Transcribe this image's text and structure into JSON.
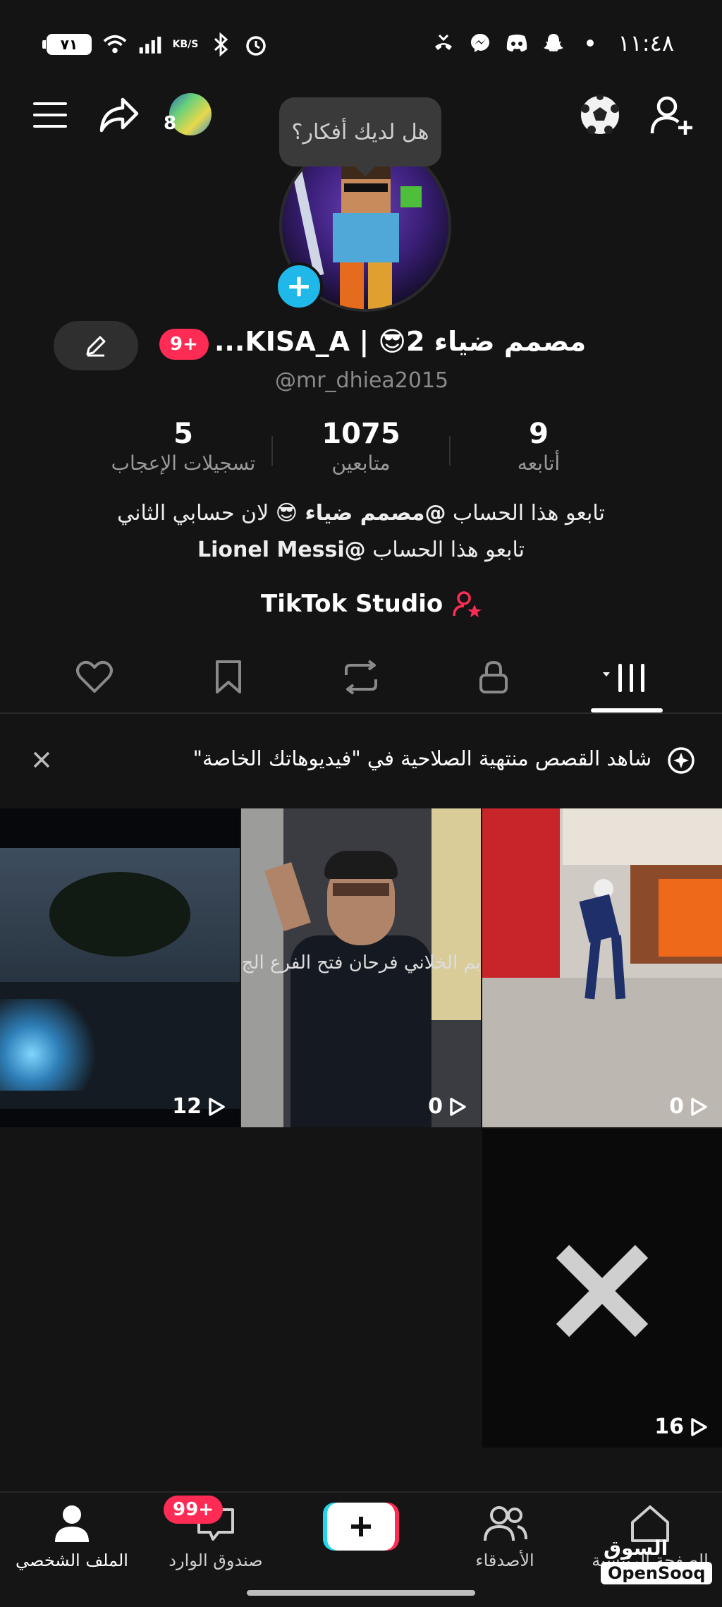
{
  "status_bar": {
    "time": "١١:٤٨",
    "battery": "٧١",
    "speed_unit": "KB/S"
  },
  "top_nav": {
    "followers_avatar_count": "8",
    "ideas_tooltip": "هل لديك أفكار؟"
  },
  "profile": {
    "display_name": "مصمم ضياء 2😎 | KISA_A...",
    "badge": "9+",
    "handle": "@mr_dhiea2015"
  },
  "stats": [
    {
      "value": "5",
      "label": "تسجيلات الإعجاب"
    },
    {
      "value": "1075",
      "label": "متابعين"
    },
    {
      "value": "9",
      "label": "أتابعه"
    }
  ],
  "bio": {
    "line1_a": "تابعو هذا الحساب ",
    "line1_mention": "@مصمم ضياء 😎",
    "line1_b": " لان حسابي الثاني",
    "line2_a": "تابعو هذا الحساب ",
    "line2_mention": "@Lionel Messi"
  },
  "studio_link": "TikTok Studio",
  "notice": {
    "text": "شاهد القصص منتهية الصلاحية في \"فيديوهاتك الخاصة\""
  },
  "videos": [
    {
      "views": "12"
    },
    {
      "views": "0",
      "overlay": "يم الخلاني فرحان فتح الفرع الج"
    },
    {
      "views": "0"
    },
    {
      "views": "16"
    }
  ],
  "bottom_nav": {
    "home": "الصفحة الرئيسية",
    "friends": "الأصدقاء",
    "inbox": "صندوق الوارد",
    "inbox_badge": "99+",
    "profile": "الملف الشخصي"
  },
  "watermark": {
    "arabic": "السوق المفتوح",
    "latin": "OpenSooq"
  },
  "colors": {
    "background": "#141414",
    "accent_red": "#fe2c55",
    "accent_cyan": "#20b8e8"
  }
}
